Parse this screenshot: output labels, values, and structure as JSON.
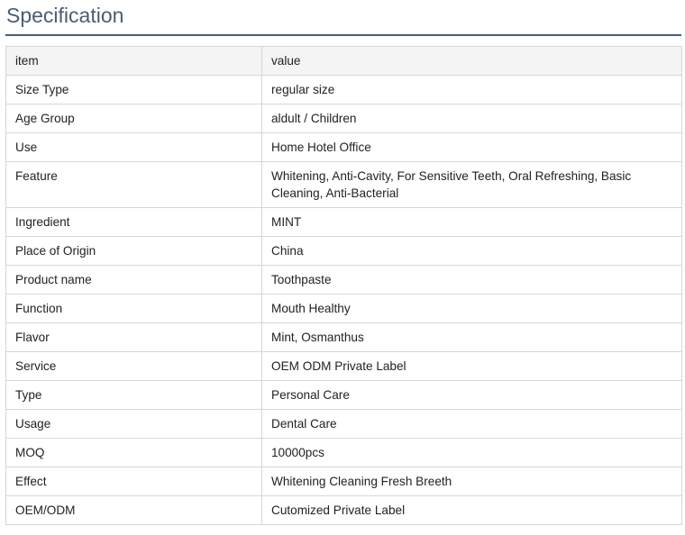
{
  "page": {
    "title": "Specification"
  },
  "table": {
    "headers": [
      "item",
      "value"
    ],
    "rows": [
      [
        "Size Type",
        "regular size"
      ],
      [
        "Age Group",
        "aldult / Children"
      ],
      [
        "Use",
        "Home Hotel Office"
      ],
      [
        "Feature",
        "Whitening, Anti-Cavity, For Sensitive Teeth, Oral Refreshing, Basic Cleaning, Anti-Bacterial"
      ],
      [
        "Ingredient",
        "MINT"
      ],
      [
        "Place of Origin",
        "China"
      ],
      [
        "Product name",
        "Toothpaste"
      ],
      [
        "Function",
        "Mouth Healthy"
      ],
      [
        "Flavor",
        "Mint, Osmanthus"
      ],
      [
        "Service",
        "OEM ODM Private Label"
      ],
      [
        "Type",
        "Personal Care"
      ],
      [
        "Usage",
        "Dental Care"
      ],
      [
        "MOQ",
        "10000pcs"
      ],
      [
        "Effect",
        "Whitening Cleaning Fresh Breeth"
      ],
      [
        "OEM/ODM",
        "Cutomized Private Label"
      ]
    ]
  },
  "colors": {
    "title": "#4a5d75",
    "border": "#d6d6d6",
    "header_bg": "#f4f4f4",
    "text": "#222222"
  }
}
